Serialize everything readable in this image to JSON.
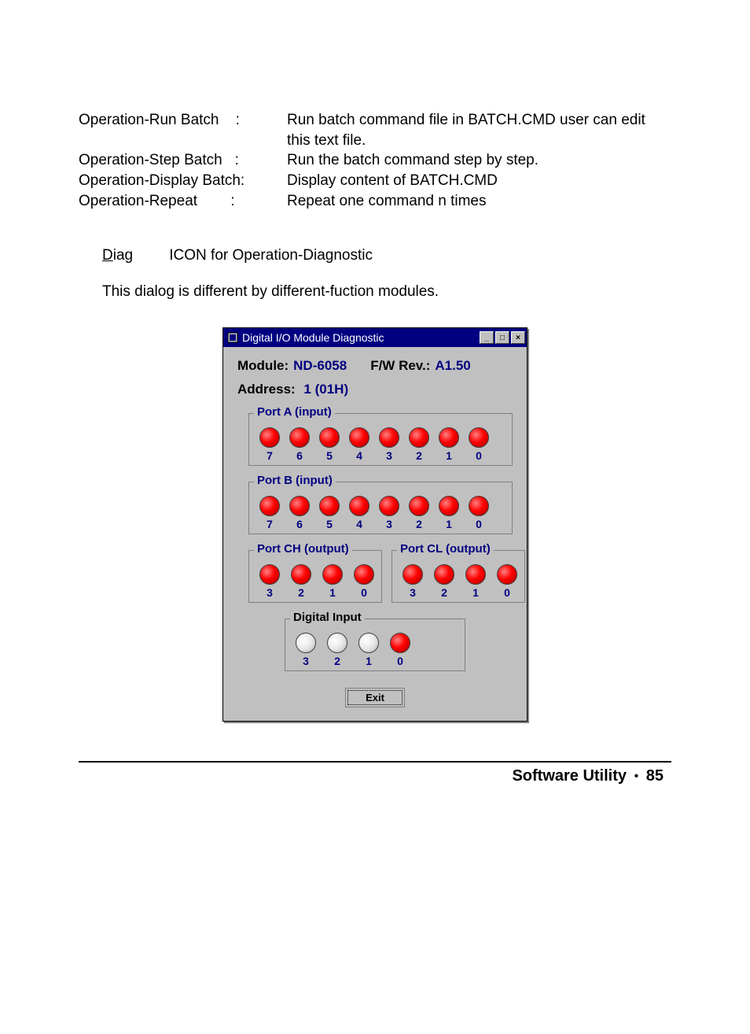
{
  "ops": [
    {
      "name": "Operation-Run Batch",
      "sep": ":",
      "desc": "Run batch command file in BATCH.CMD user can edit this text file."
    },
    {
      "name": "Operation-Step Batch",
      "sep": ":",
      "desc": "Run the batch command step by step."
    },
    {
      "name": "Operation-Display Batch:",
      "sep": "",
      "desc": "Display content of BATCH.CMD"
    },
    {
      "name": "Operation-Repeat",
      "sep": ":",
      "desc": "Repeat one command n times"
    }
  ],
  "diag": {
    "underline": "D",
    "rest": "iag",
    "text": "ICON for Operation-Diagnostic"
  },
  "desc": "This dialog is different by different-fuction modules.",
  "window": {
    "title": "Digital I/O Module Diagnostic",
    "module_label": "Module:",
    "module_value": "ND-6058",
    "fw_label": "F/W Rev.:",
    "fw_value": "A1.50",
    "address_label": "Address:",
    "address_value": "1 (01H)",
    "ports": {
      "A": {
        "legend": "Port A (input)",
        "bits": [
          "7",
          "6",
          "5",
          "4",
          "3",
          "2",
          "1",
          "0"
        ],
        "states": [
          "on",
          "on",
          "on",
          "on",
          "on",
          "on",
          "on",
          "on"
        ]
      },
      "B": {
        "legend": "Port B (input)",
        "bits": [
          "7",
          "6",
          "5",
          "4",
          "3",
          "2",
          "1",
          "0"
        ],
        "states": [
          "on",
          "on",
          "on",
          "on",
          "on",
          "on",
          "on",
          "on"
        ]
      },
      "CH": {
        "legend": "Port CH (output)",
        "bits": [
          "3",
          "2",
          "1",
          "0"
        ],
        "states": [
          "on",
          "on",
          "on",
          "on"
        ]
      },
      "CL": {
        "legend": "Port CL (output)",
        "bits": [
          "3",
          "2",
          "1",
          "0"
        ],
        "states": [
          "on",
          "on",
          "on",
          "on"
        ]
      },
      "DI": {
        "legend": "Digital Input",
        "bits": [
          "3",
          "2",
          "1",
          "0"
        ],
        "states": [
          "off",
          "off",
          "off",
          "on"
        ]
      }
    },
    "exit": "Exit",
    "btn_min": "_",
    "btn_max": "□",
    "btn_close": "×"
  },
  "footer": {
    "left": "Software Utility",
    "bullet": "•",
    "page": "85"
  }
}
